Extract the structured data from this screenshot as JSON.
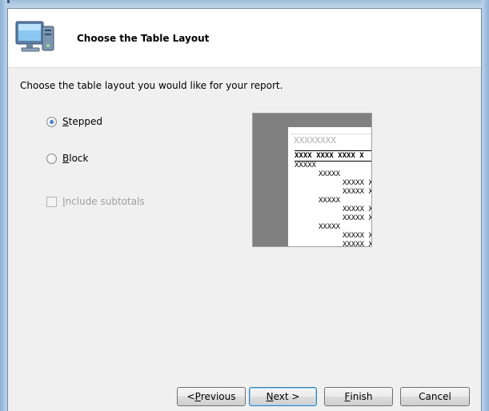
{
  "header": {
    "title": "Choose the Table Layout",
    "icon": "computer-icon"
  },
  "instruction": "Choose the table layout you would like for your report.",
  "layout_options": [
    {
      "label": "Stepped",
      "mnemonic": "S",
      "rest": "tepped",
      "checked": true
    },
    {
      "label": "Block",
      "mnemonic": "B",
      "rest": "lock",
      "checked": false
    }
  ],
  "subtotals": {
    "label": "Include subtotals",
    "mnemonic": "I",
    "rest": "nclude subtotals",
    "checked": false,
    "enabled": false
  },
  "preview": {
    "title": "XXXXXXXX",
    "header_row": "XXXX XXXX XXXX X",
    "rows": [
      "XXXXX",
      "XXXXX",
      "XXXXX X",
      "XXXXX X",
      "XXXXX",
      "XXXXX X",
      "XXXXX X",
      "XXXXX",
      "XXXXX X",
      "XXXXX X"
    ]
  },
  "buttons": {
    "previous": {
      "label": "< Previous",
      "pre": "< ",
      "mnemonic": "P",
      "rest": "revious"
    },
    "next": {
      "label": "Next >",
      "mnemonic": "N",
      "rest": "ext >"
    },
    "finish": {
      "label": "Finish",
      "mnemonic": "F",
      "rest": "inish"
    },
    "cancel": {
      "label": "Cancel"
    }
  },
  "colors": {
    "accent": "#3c7fb1",
    "preview_background": "#808080"
  }
}
